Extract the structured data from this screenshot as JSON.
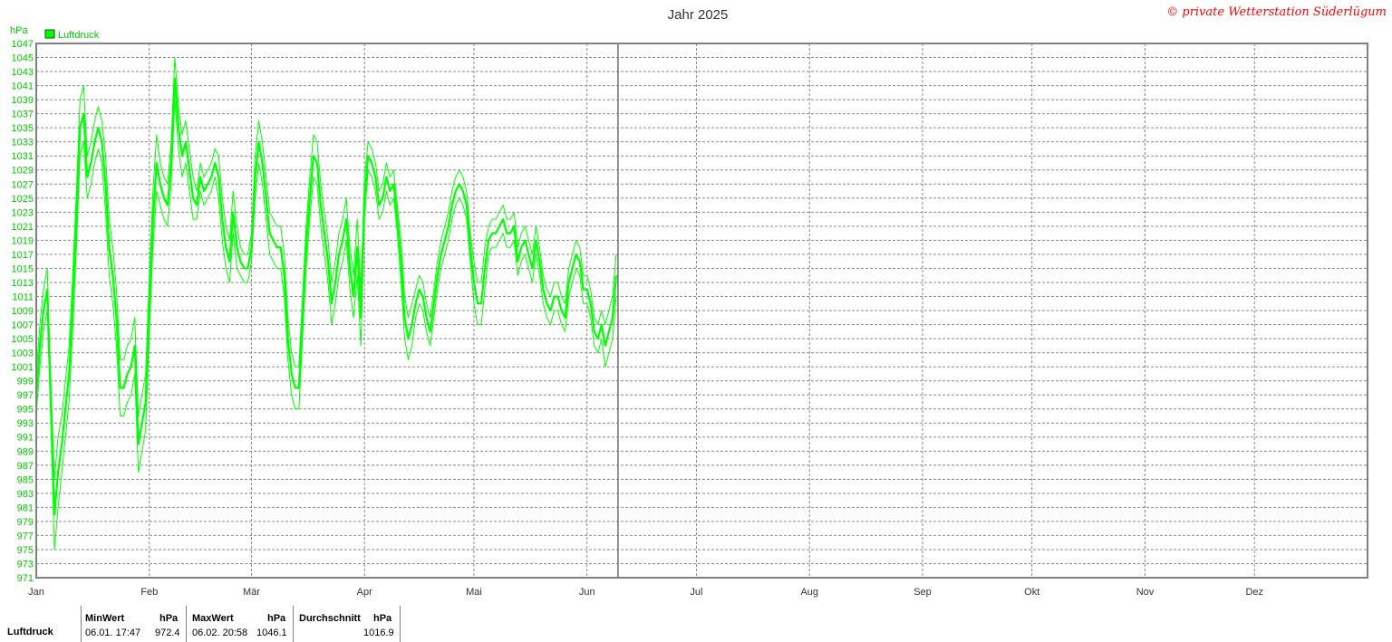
{
  "title": "Jahr 2025",
  "copyright": "© private Wetterstation Süderlügum",
  "unit_label": "hPa",
  "legend_label": "Luftdruck",
  "colors": {
    "series": "#00ff00",
    "axis_text": "#00c800",
    "copyright": "#ff0000",
    "grid": "#808080"
  },
  "chart_data": {
    "type": "line",
    "title": "Jahr 2025",
    "ylabel": "hPa",
    "ylim": [
      971,
      1047
    ],
    "yticks": [
      971,
      973,
      975,
      977,
      979,
      981,
      983,
      985,
      987,
      989,
      991,
      993,
      995,
      997,
      999,
      1001,
      1003,
      1005,
      1007,
      1009,
      1011,
      1013,
      1015,
      1017,
      1019,
      1021,
      1023,
      1025,
      1027,
      1029,
      1031,
      1033,
      1035,
      1037,
      1039,
      1041,
      1043,
      1045,
      1047
    ],
    "months": [
      "Jan",
      "Feb",
      "Mär",
      "Apr",
      "Mai",
      "Jun",
      "Jul",
      "Aug",
      "Sep",
      "Okt",
      "Nov",
      "Dez"
    ],
    "grid": true,
    "current_day": 160,
    "series": [
      {
        "name": "Luftdruck",
        "x": [
          1,
          2,
          3,
          4,
          5,
          6,
          7,
          8,
          9,
          10,
          11,
          12,
          13,
          14,
          15,
          16,
          17,
          18,
          19,
          20,
          21,
          22,
          23,
          24,
          25,
          26,
          27,
          28,
          29,
          30,
          31,
          32,
          33,
          34,
          35,
          36,
          37,
          38,
          39,
          40,
          41,
          42,
          43,
          44,
          45,
          46,
          47,
          48,
          49,
          50,
          51,
          52,
          53,
          54,
          55,
          56,
          57,
          58,
          59,
          60,
          61,
          62,
          63,
          64,
          65,
          66,
          67,
          68,
          69,
          70,
          71,
          72,
          73,
          74,
          75,
          76,
          77,
          78,
          79,
          80,
          81,
          82,
          83,
          84,
          85,
          86,
          87,
          88,
          89,
          90,
          91,
          92,
          93,
          94,
          95,
          96,
          97,
          98,
          99,
          100,
          101,
          102,
          103,
          104,
          105,
          106,
          107,
          108,
          109,
          110,
          111,
          112,
          113,
          114,
          115,
          116,
          117,
          118,
          119,
          120,
          121,
          122,
          123,
          124,
          125,
          126,
          127,
          128,
          129,
          130,
          131,
          132,
          133,
          134,
          135,
          136,
          137,
          138,
          139,
          140,
          141,
          142,
          143,
          144,
          145,
          146,
          147,
          148,
          149,
          150,
          151,
          152,
          153,
          154,
          155,
          156,
          157,
          158,
          159,
          160
        ],
        "mean": [
          997,
          1004,
          1009,
          1012,
          996,
          980,
          986,
          990,
          995,
          1000,
          1010,
          1022,
          1035,
          1037,
          1028,
          1030,
          1033,
          1035,
          1033,
          1027,
          1018,
          1014,
          1008,
          998,
          998,
          1000,
          1001,
          1004,
          990,
          993,
          996,
          1010,
          1022,
          1030,
          1027,
          1025,
          1024,
          1030,
          1042,
          1035,
          1031,
          1033,
          1029,
          1025,
          1024,
          1028,
          1026,
          1027,
          1028,
          1030,
          1028,
          1022,
          1018,
          1016,
          1023,
          1018,
          1016,
          1015,
          1015,
          1018,
          1028,
          1033,
          1030,
          1025,
          1020,
          1019,
          1018,
          1018,
          1014,
          1005,
          1000,
          998,
          998,
          1008,
          1018,
          1025,
          1031,
          1030,
          1024,
          1020,
          1016,
          1010,
          1013,
          1017,
          1019,
          1022,
          1015,
          1011,
          1018,
          1008,
          1025,
          1031,
          1030,
          1028,
          1024,
          1025,
          1028,
          1026,
          1027,
          1022,
          1016,
          1008,
          1005,
          1007,
          1010,
          1012,
          1011,
          1008,
          1006,
          1010,
          1014,
          1017,
          1019,
          1021,
          1024,
          1026,
          1027,
          1026,
          1024,
          1018,
          1013,
          1010,
          1010,
          1015,
          1019,
          1020,
          1020,
          1021,
          1022,
          1020,
          1020,
          1021,
          1016,
          1018,
          1019,
          1017,
          1015,
          1019,
          1016,
          1012,
          1010,
          1009,
          1011,
          1011,
          1009,
          1008,
          1013,
          1015,
          1017,
          1016,
          1012,
          1012,
          1010,
          1006,
          1005,
          1007,
          1004,
          1006,
          1008,
          1014
        ],
        "spread": [
          3,
          3,
          3,
          3,
          3,
          5,
          5,
          4,
          4,
          4,
          4,
          4,
          4,
          4,
          3,
          3,
          3,
          3,
          3,
          4,
          4,
          4,
          4,
          4,
          4,
          4,
          4,
          4,
          4,
          4,
          4,
          4,
          4,
          4,
          3,
          3,
          3,
          3,
          3,
          3,
          3,
          3,
          3,
          3,
          2,
          2,
          2,
          2,
          2,
          2,
          3,
          3,
          3,
          3,
          3,
          3,
          2,
          2,
          2,
          2,
          3,
          3,
          3,
          3,
          3,
          3,
          3,
          3,
          3,
          3,
          3,
          3,
          3,
          3,
          3,
          3,
          3,
          3,
          3,
          3,
          3,
          3,
          3,
          3,
          3,
          3,
          3,
          3,
          4,
          4,
          3,
          2,
          2,
          2,
          2,
          2,
          2,
          2,
          2,
          2,
          3,
          3,
          3,
          3,
          2,
          2,
          2,
          2,
          2,
          2,
          2,
          2,
          2,
          2,
          2,
          2,
          2,
          2,
          2,
          2,
          3,
          3,
          3,
          3,
          2,
          2,
          2,
          2,
          2,
          2,
          2,
          2,
          2,
          2,
          2,
          2,
          2,
          2,
          2,
          2,
          2,
          2,
          2,
          2,
          2,
          2,
          2,
          2,
          2,
          2,
          2,
          2,
          2,
          2,
          2,
          2,
          3,
          3,
          3,
          3
        ]
      }
    ]
  },
  "stats": {
    "row_label": "Luftdruck",
    "min_header": "MinWert",
    "min_unit": "hPa",
    "min_date": "06.01.  17:47",
    "min_value": "972.4",
    "max_header": "MaxWert",
    "max_unit": "hPa",
    "max_date": "06.02.  20:58",
    "max_value": "1046.1",
    "avg_header": "Durchschnitt",
    "avg_unit": "hPa",
    "avg_value": "1016.9"
  }
}
